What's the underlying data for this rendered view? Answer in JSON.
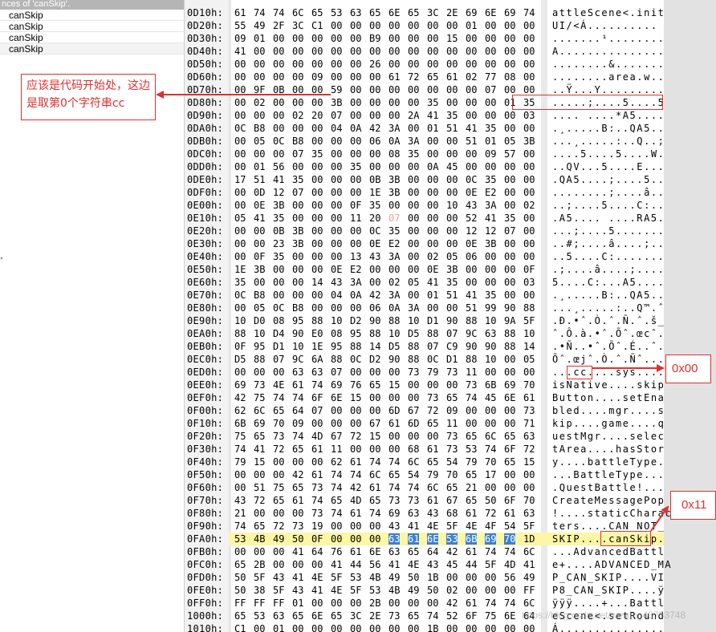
{
  "results_panel": {
    "header": "nces of 'canSkip'.",
    "items": [
      "canSkip",
      "canSkip",
      "canSkip",
      "canSkip"
    ]
  },
  "hex_rows": [
    {
      "offset": "0D10h:",
      "bytes": [
        "61",
        "74",
        "74",
        "6C",
        "65",
        "53",
        "63",
        "65",
        "6E",
        "65",
        "3C",
        "2E",
        "69",
        "6E",
        "69",
        "74"
      ],
      "ascii": "attleScene<.init"
    },
    {
      "offset": "0D20h:",
      "bytes": [
        "55",
        "49",
        "2F",
        "3C",
        "C1",
        "00",
        "00",
        "00",
        "00",
        "00",
        "00",
        "00",
        "01",
        "00",
        "00",
        "00"
      ],
      "ascii": "UI/<Á.........."
    },
    {
      "offset": "0D30h:",
      "bytes": [
        "09",
        "01",
        "00",
        "00",
        "00",
        "00",
        "00",
        "B9",
        "00",
        "00",
        "00",
        "15",
        "00",
        "00",
        "00",
        "00"
      ],
      "ascii": ".......¹........"
    },
    {
      "offset": "0D40h:",
      "bytes": [
        "41",
        "00",
        "00",
        "00",
        "00",
        "00",
        "00",
        "00",
        "00",
        "00",
        "00",
        "00",
        "00",
        "00",
        "00",
        "00"
      ],
      "ascii": "A..............."
    },
    {
      "offset": "0D50h:",
      "bytes": [
        "00",
        "00",
        "00",
        "00",
        "00",
        "00",
        "00",
        "26",
        "00",
        "00",
        "00",
        "00",
        "00",
        "00",
        "00",
        "00"
      ],
      "ascii": "........&......."
    },
    {
      "offset": "0D60h:",
      "bytes": [
        "00",
        "00",
        "00",
        "00",
        "09",
        "00",
        "00",
        "00",
        "61",
        "72",
        "65",
        "61",
        "02",
        "77",
        "08",
        "00"
      ],
      "ascii": "........area.w.."
    },
    {
      "offset": "0D70h:",
      "bytes": [
        "00",
        "9F",
        "0B",
        "00",
        "00",
        "59",
        "00",
        "00",
        "00",
        "00",
        "00",
        "00",
        "00",
        "07",
        "00",
        "00"
      ],
      "ascii": "..Ÿ...Y........."
    },
    {
      "offset": "0D80h:",
      "bytes": [
        "00",
        "02",
        "00",
        "00",
        "00",
        "3B",
        "00",
        "00",
        "00",
        "00",
        "35",
        "00",
        "00",
        "00",
        "01",
        "35"
      ],
      "ascii": ".....;....5....5"
    },
    {
      "offset": "0D90h:",
      "bytes": [
        "00",
        "00",
        "00",
        "02",
        "20",
        "07",
        "00",
        "00",
        "00",
        "2A",
        "41",
        "35",
        "00",
        "00",
        "00",
        "03"
      ],
      "ascii": ".... ....*A5...."
    },
    {
      "offset": "0DA0h:",
      "bytes": [
        "0C",
        "B8",
        "00",
        "00",
        "00",
        "04",
        "0A",
        "42",
        "3A",
        "00",
        "01",
        "51",
        "41",
        "35",
        "00",
        "00"
      ],
      "ascii": ".¸.....B:..QA5.."
    },
    {
      "offset": "0DB0h:",
      "bytes": [
        "00",
        "05",
        "0C",
        "B8",
        "00",
        "00",
        "00",
        "06",
        "0A",
        "3A",
        "00",
        "00",
        "51",
        "01",
        "05",
        "3B"
      ],
      "ascii": "...¸.....:..Q..;"
    },
    {
      "offset": "0DC0h:",
      "bytes": [
        "00",
        "00",
        "00",
        "07",
        "35",
        "00",
        "00",
        "00",
        "08",
        "35",
        "00",
        "00",
        "00",
        "09",
        "57",
        "00"
      ],
      "ascii": "....5....5....W."
    },
    {
      "offset": "0DD0h:",
      "bytes": [
        "00",
        "01",
        "56",
        "00",
        "00",
        "00",
        "35",
        "00",
        "00",
        "00",
        "0A",
        "45",
        "00",
        "00",
        "00",
        "00"
      ],
      "ascii": "..QV...5....E..."
    },
    {
      "offset": "0DE0h:",
      "bytes": [
        "17",
        "51",
        "41",
        "35",
        "00",
        "00",
        "00",
        "0B",
        "3B",
        "00",
        "00",
        "00",
        "0C",
        "35",
        "00",
        "00"
      ],
      "ascii": ".QA5....;....5.."
    },
    {
      "offset": "0DF0h:",
      "bytes": [
        "00",
        "0D",
        "12",
        "07",
        "00",
        "00",
        "00",
        "1E",
        "3B",
        "00",
        "00",
        "00",
        "0E",
        "E2",
        "00",
        "00"
      ],
      "ascii": "........;....â.."
    },
    {
      "offset": "0E00h:",
      "bytes": [
        "00",
        "0E",
        "3B",
        "00",
        "00",
        "00",
        "0F",
        "35",
        "00",
        "00",
        "00",
        "10",
        "43",
        "3A",
        "00",
        "02"
      ],
      "ascii": "..;....5....C:.."
    },
    {
      "offset": "0E10h:",
      "bytes": [
        "05",
        "41",
        "35",
        "00",
        "00",
        "00",
        "11",
        "20",
        "07",
        "00",
        "00",
        "00",
        "52",
        "41",
        "35",
        "00"
      ],
      "ascii": ".A5.... ....RA5."
    },
    {
      "offset": "0E20h:",
      "bytes": [
        "00",
        "00",
        "0B",
        "3B",
        "00",
        "00",
        "00",
        "0C",
        "35",
        "00",
        "00",
        "00",
        "12",
        "12",
        "07",
        "00"
      ],
      "ascii": "...;....5......."
    },
    {
      "offset": "0E30h:",
      "bytes": [
        "00",
        "00",
        "23",
        "3B",
        "00",
        "00",
        "00",
        "0E",
        "E2",
        "00",
        "00",
        "00",
        "0E",
        "3B",
        "00",
        "00"
      ],
      "ascii": "..#;....â....;.."
    },
    {
      "offset": "0E40h:",
      "bytes": [
        "00",
        "0F",
        "35",
        "00",
        "00",
        "00",
        "13",
        "43",
        "3A",
        "00",
        "02",
        "05",
        "06",
        "00",
        "00",
        "00"
      ],
      "ascii": "..5....C:......."
    },
    {
      "offset": "0E50h:",
      "bytes": [
        "1E",
        "3B",
        "00",
        "00",
        "00",
        "0E",
        "E2",
        "00",
        "00",
        "00",
        "0E",
        "3B",
        "00",
        "00",
        "00",
        "0F"
      ],
      "ascii": ".;....â....;...."
    },
    {
      "offset": "0E60h:",
      "bytes": [
        "35",
        "00",
        "00",
        "00",
        "14",
        "43",
        "3A",
        "00",
        "02",
        "05",
        "41",
        "35",
        "00",
        "00",
        "00",
        "03"
      ],
      "ascii": "5....C:...A5...."
    },
    {
      "offset": "0E70h:",
      "bytes": [
        "0C",
        "B8",
        "00",
        "00",
        "00",
        "04",
        "0A",
        "42",
        "3A",
        "00",
        "01",
        "51",
        "41",
        "35",
        "00",
        "00"
      ],
      "ascii": ".¸.....B:..QA5.."
    },
    {
      "offset": "0E80h:",
      "bytes": [
        "00",
        "05",
        "0C",
        "B8",
        "00",
        "00",
        "00",
        "06",
        "0A",
        "3A",
        "00",
        "00",
        "51",
        "99",
        "90",
        "88"
      ],
      "ascii": "...¸.....:..Q™.ˆ"
    },
    {
      "offset": "0E90h:",
      "bytes": [
        "10",
        "D0",
        "08",
        "95",
        "88",
        "10",
        "D2",
        "90",
        "88",
        "10",
        "D1",
        "90",
        "88",
        "10",
        "9A",
        "5F"
      ],
      "ascii": ".Ð.•ˆ.Ò.ˆ.Ñ.ˆ.š_"
    },
    {
      "offset": "0EA0h:",
      "bytes": [
        "88",
        "10",
        "D4",
        "90",
        "E0",
        "08",
        "95",
        "88",
        "10",
        "D5",
        "88",
        "07",
        "9C",
        "63",
        "88",
        "10"
      ],
      "ascii": "ˆ.Ô.à.•ˆ.Õˆ.œcˆ."
    },
    {
      "offset": "0EB0h:",
      "bytes": [
        "0F",
        "95",
        "D1",
        "10",
        "1E",
        "95",
        "88",
        "14",
        "D5",
        "88",
        "07",
        "C9",
        "90",
        "90",
        "88",
        "14"
      ],
      "ascii": ".•Ñ..•ˆ.Õˆ.É..ˆ."
    },
    {
      "offset": "0EC0h:",
      "bytes": [
        "D5",
        "88",
        "07",
        "9C",
        "6A",
        "88",
        "0C",
        "D2",
        "90",
        "88",
        "0C",
        "D1",
        "88",
        "10",
        "00",
        "05"
      ],
      "ascii": "Õˆ.œjˆ.Ò.ˆ.Ñˆ..."
    },
    {
      "offset": "0ED0h:",
      "bytes": [
        "00",
        "00",
        "00",
        "63",
        "63",
        "07",
        "00",
        "00",
        "00",
        "73",
        "79",
        "73",
        "11",
        "00",
        "00",
        "00"
      ],
      "ascii": "...cc....sys...."
    },
    {
      "offset": "0EE0h:",
      "bytes": [
        "69",
        "73",
        "4E",
        "61",
        "74",
        "69",
        "76",
        "65",
        "15",
        "00",
        "00",
        "00",
        "73",
        "6B",
        "69",
        "70"
      ],
      "ascii": "isNative....skip"
    },
    {
      "offset": "0EF0h:",
      "bytes": [
        "42",
        "75",
        "74",
        "74",
        "6F",
        "6E",
        "15",
        "00",
        "00",
        "00",
        "73",
        "65",
        "74",
        "45",
        "6E",
        "61"
      ],
      "ascii": "Button....setEna"
    },
    {
      "offset": "0F00h:",
      "bytes": [
        "62",
        "6C",
        "65",
        "64",
        "07",
        "00",
        "00",
        "00",
        "6D",
        "67",
        "72",
        "09",
        "00",
        "00",
        "00",
        "73"
      ],
      "ascii": "bled....mgr....s"
    },
    {
      "offset": "0F10h:",
      "bytes": [
        "6B",
        "69",
        "70",
        "09",
        "00",
        "00",
        "00",
        "67",
        "61",
        "6D",
        "65",
        "11",
        "00",
        "00",
        "00",
        "71"
      ],
      "ascii": "kip....game....q"
    },
    {
      "offset": "0F20h:",
      "bytes": [
        "75",
        "65",
        "73",
        "74",
        "4D",
        "67",
        "72",
        "15",
        "00",
        "00",
        "00",
        "73",
        "65",
        "6C",
        "65",
        "63"
      ],
      "ascii": "uestMgr....selec"
    },
    {
      "offset": "0F30h:",
      "bytes": [
        "74",
        "41",
        "72",
        "65",
        "61",
        "11",
        "00",
        "00",
        "00",
        "68",
        "61",
        "73",
        "53",
        "74",
        "6F",
        "72"
      ],
      "ascii": "tArea....hasStor"
    },
    {
      "offset": "0F40h:",
      "bytes": [
        "79",
        "15",
        "00",
        "00",
        "00",
        "62",
        "61",
        "74",
        "74",
        "6C",
        "65",
        "54",
        "79",
        "70",
        "65",
        "15"
      ],
      "ascii": "y....battleType."
    },
    {
      "offset": "0F50h:",
      "bytes": [
        "00",
        "00",
        "00",
        "42",
        "61",
        "74",
        "74",
        "6C",
        "65",
        "54",
        "79",
        "70",
        "65",
        "17",
        "00",
        "00"
      ],
      "ascii": "...BattleType..."
    },
    {
      "offset": "0F60h:",
      "bytes": [
        "00",
        "51",
        "75",
        "65",
        "73",
        "74",
        "42",
        "61",
        "74",
        "74",
        "6C",
        "65",
        "21",
        "00",
        "00",
        "00"
      ],
      "ascii": ".QuestBattle!..."
    },
    {
      "offset": "0F70h:",
      "bytes": [
        "43",
        "72",
        "65",
        "61",
        "74",
        "65",
        "4D",
        "65",
        "73",
        "73",
        "61",
        "67",
        "65",
        "50",
        "6F",
        "70"
      ],
      "ascii": "CreateMessagePop"
    },
    {
      "offset": "0F80h:",
      "bytes": [
        "21",
        "00",
        "00",
        "00",
        "73",
        "74",
        "61",
        "74",
        "69",
        "63",
        "43",
        "68",
        "61",
        "72",
        "61",
        "63"
      ],
      "ascii": "!....staticCharac"
    },
    {
      "offset": "0F90h:",
      "bytes": [
        "74",
        "65",
        "72",
        "73",
        "19",
        "00",
        "00",
        "00",
        "43",
        "41",
        "4E",
        "5F",
        "4E",
        "4F",
        "54",
        "5F"
      ],
      "ascii": "ters....CAN_NOT_"
    },
    {
      "offset": "0FA0h:",
      "bytes": [
        "53",
        "4B",
        "49",
        "50",
        "0F",
        "00",
        "00",
        "00",
        "63",
        "61",
        "6E",
        "53",
        "6B",
        "69",
        "70",
        "1D"
      ],
      "ascii": "SKIP....canSkip."
    },
    {
      "offset": "0FB0h:",
      "bytes": [
        "00",
        "00",
        "00",
        "41",
        "64",
        "76",
        "61",
        "6E",
        "63",
        "65",
        "64",
        "42",
        "61",
        "74",
        "74",
        "6C"
      ],
      "ascii": "...AdvancedBattl"
    },
    {
      "offset": "0FC0h:",
      "bytes": [
        "65",
        "2B",
        "00",
        "00",
        "00",
        "41",
        "44",
        "56",
        "41",
        "4E",
        "43",
        "45",
        "44",
        "5F",
        "4D",
        "41"
      ],
      "ascii": "e+....ADVANCED_MA"
    },
    {
      "offset": "0FD0h:",
      "bytes": [
        "50",
        "5F",
        "43",
        "41",
        "4E",
        "5F",
        "53",
        "4B",
        "49",
        "50",
        "1B",
        "00",
        "00",
        "00",
        "56",
        "49"
      ],
      "ascii": "P_CAN_SKIP....VI"
    },
    {
      "offset": "0FE0h:",
      "bytes": [
        "50",
        "38",
        "5F",
        "43",
        "41",
        "4E",
        "5F",
        "53",
        "4B",
        "49",
        "50",
        "02",
        "00",
        "00",
        "00",
        "FF"
      ],
      "ascii": "P8_CAN_SKIP....ÿ"
    },
    {
      "offset": "0FF0h:",
      "bytes": [
        "FF",
        "FF",
        "FF",
        "01",
        "00",
        "00",
        "00",
        "2B",
        "00",
        "00",
        "00",
        "42",
        "61",
        "74",
        "74",
        "6C"
      ],
      "ascii": "ÿÿÿ....+...Battl"
    },
    {
      "offset": "1000h:",
      "bytes": [
        "65",
        "53",
        "63",
        "65",
        "6E",
        "65",
        "3C",
        "2E",
        "73",
        "65",
        "74",
        "52",
        "6F",
        "75",
        "6E",
        "64"
      ],
      "ascii": "eScene<.setRound"
    },
    {
      "offset": "1010h:",
      "bytes": [
        "C1",
        "00",
        "01",
        "00",
        "00",
        "00",
        "00",
        "00",
        "00",
        "00",
        "1B",
        "00",
        "00",
        "00",
        "00",
        "00"
      ],
      "ascii": "Á..............."
    }
  ],
  "annotations": {
    "left_note": "应该是代码开始处，这边是取第0个字符串cc",
    "note_00": "0x00",
    "note_11": "0x11"
  },
  "watermark": "https://blog.csdn.net/weixin_43753748",
  "colors": {
    "highlight_row": "#fdf6a4",
    "selection": "#3b7fd6",
    "annotation_red": "#e03030"
  }
}
